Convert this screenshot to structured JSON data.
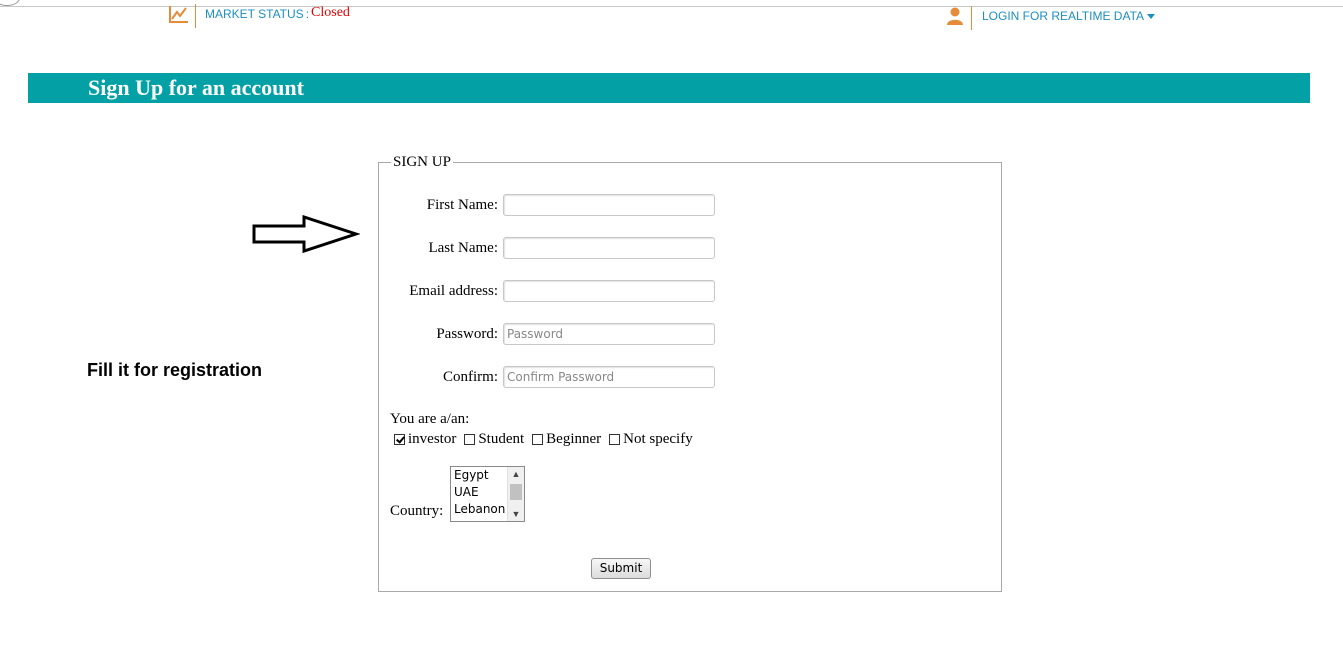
{
  "topbar": {
    "market_label": "MARKET STATUS",
    "market_colon": ":",
    "market_value": "Closed",
    "login_label": "LOGIN FOR REALTIME DATA",
    "chart_icon": "chart-line-icon",
    "user_icon": "user-icon",
    "dropdown_icon": "caret-down-icon"
  },
  "banner": {
    "title": "Sign Up for an account"
  },
  "annotation": {
    "text": "Fill it for registration",
    "icon": "arrow-right-icon"
  },
  "form": {
    "legend": "SIGN UP",
    "fields": [
      {
        "label": "First Name:",
        "value": "",
        "placeholder": ""
      },
      {
        "label": "Last Name:",
        "value": "",
        "placeholder": ""
      },
      {
        "label": "Email address:",
        "value": "",
        "placeholder": ""
      },
      {
        "label": "Password:",
        "value": "",
        "placeholder": "Password"
      },
      {
        "label": "Confirm:",
        "value": "",
        "placeholder": "Confirm Password"
      }
    ],
    "role_label": "You are a/an:",
    "roles": [
      {
        "label": "investor",
        "checked": true
      },
      {
        "label": "Student",
        "checked": false
      },
      {
        "label": "Beginner",
        "checked": false
      },
      {
        "label": "Not specify",
        "checked": false
      }
    ],
    "country_label": "Country:",
    "countries": [
      "Egypt",
      "UAE",
      "Lebanon"
    ],
    "submit_label": "Submit"
  },
  "colors": {
    "banner": "#03a1a6",
    "link": "#1d8fc0",
    "status_closed": "#e00000",
    "accent": "#e58c3a"
  }
}
